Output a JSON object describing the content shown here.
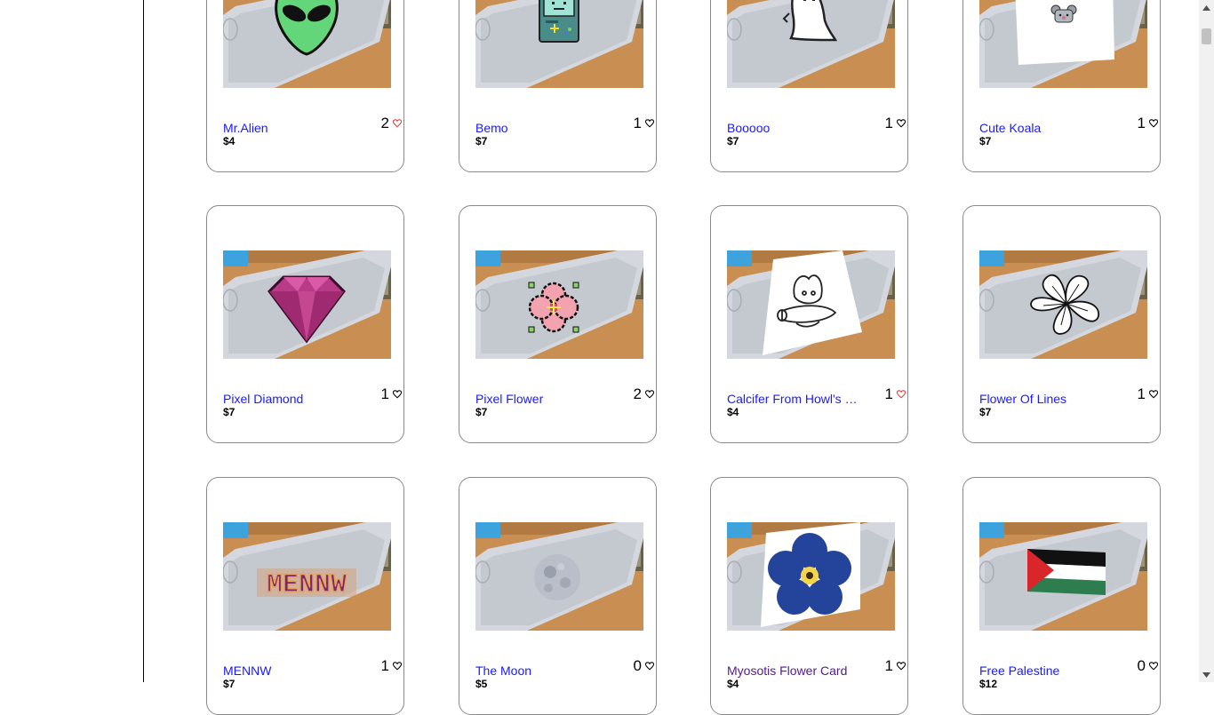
{
  "products": [
    {
      "title": "Mr.Alien",
      "price": "$4",
      "likes": "2",
      "liked": true,
      "sticker": "alien"
    },
    {
      "title": "Bemo",
      "price": "$7",
      "likes": "1",
      "liked": false,
      "sticker": "bemo"
    },
    {
      "title": "Booooo",
      "price": "$7",
      "likes": "1",
      "liked": false,
      "sticker": "ghost"
    },
    {
      "title": "Cute Koala",
      "price": "$7",
      "likes": "1",
      "liked": false,
      "sticker": "koala"
    },
    {
      "title": "Pixel Diamond",
      "price": "$7",
      "likes": "1",
      "liked": false,
      "sticker": "diamond"
    },
    {
      "title": "Pixel Flower",
      "price": "$7",
      "likes": "2",
      "liked": false,
      "sticker": "pixelflower"
    },
    {
      "title": "Calcifer From Howl's Moving Castle",
      "price": "$4",
      "likes": "1",
      "liked": true,
      "sticker": "calcifer"
    },
    {
      "title": "Flower Of Lines",
      "price": "$7",
      "likes": "1",
      "liked": false,
      "sticker": "lineflower"
    },
    {
      "title": "MENNW",
      "price": "$7",
      "likes": "1",
      "liked": false,
      "sticker": "mennw"
    },
    {
      "title": "The Moon",
      "price": "$5",
      "likes": "0",
      "liked": false,
      "sticker": "moon"
    },
    {
      "title": "Myosotis Flower Card",
      "price": "$4",
      "likes": "1",
      "liked": false,
      "sticker": "myosotis",
      "visited": true
    },
    {
      "title": "Free Palestine",
      "price": "$12",
      "likes": "0",
      "liked": false,
      "sticker": "flag"
    }
  ],
  "colors": {
    "link": "#1a1aff",
    "visited": "#551a8b",
    "liked_heart": "#e0443e",
    "heart": "#000000"
  },
  "scroll": {
    "position_fraction": 0.02,
    "thumb_fraction": 0.025
  }
}
